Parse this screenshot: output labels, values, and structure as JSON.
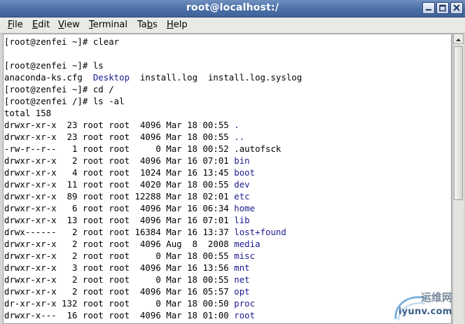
{
  "window": {
    "title": "root@localhost:/"
  },
  "menu": [
    {
      "pre": "",
      "key": "F",
      "post": "ile"
    },
    {
      "pre": "",
      "key": "E",
      "post": "dit"
    },
    {
      "pre": "",
      "key": "V",
      "post": "iew"
    },
    {
      "pre": "",
      "key": "T",
      "post": "erminal"
    },
    {
      "pre": "Ta",
      "key": "b",
      "post": "s"
    },
    {
      "pre": "",
      "key": "H",
      "post": "elp"
    }
  ],
  "terminal": {
    "lines": [
      [
        {
          "t": "[root@zenfei ~]# clear"
        }
      ],
      [
        {
          "t": ""
        }
      ],
      [
        {
          "t": "[root@zenfei ~]# ls"
        }
      ],
      [
        {
          "t": "anaconda-ks.cfg  "
        },
        {
          "t": "Desktop",
          "c": "dir"
        },
        {
          "t": "  install.log  install.log.syslog"
        }
      ],
      [
        {
          "t": "[root@zenfei ~]# cd /"
        }
      ],
      [
        {
          "t": "[root@zenfei /]# ls -al"
        }
      ],
      [
        {
          "t": "total 158"
        }
      ],
      [
        {
          "t": "drwxr-xr-x  23 root root  4096 Mar 18 00:55 "
        },
        {
          "t": ".",
          "c": "dir"
        }
      ],
      [
        {
          "t": "drwxr-xr-x  23 root root  4096 Mar 18 00:55 "
        },
        {
          "t": "..",
          "c": "dir"
        }
      ],
      [
        {
          "t": "-rw-r--r--   1 root root     0 Mar 18 00:52 .autofsck"
        }
      ],
      [
        {
          "t": "drwxr-xr-x   2 root root  4096 Mar 16 07:01 "
        },
        {
          "t": "bin",
          "c": "dir"
        }
      ],
      [
        {
          "t": "drwxr-xr-x   4 root root  1024 Mar 16 13:45 "
        },
        {
          "t": "boot",
          "c": "dir"
        }
      ],
      [
        {
          "t": "drwxr-xr-x  11 root root  4020 Mar 18 00:55 "
        },
        {
          "t": "dev",
          "c": "dir"
        }
      ],
      [
        {
          "t": "drwxr-xr-x  89 root root 12288 Mar 18 02:01 "
        },
        {
          "t": "etc",
          "c": "dir"
        }
      ],
      [
        {
          "t": "drwxr-xr-x   6 root root  4096 Mar 16 06:34 "
        },
        {
          "t": "home",
          "c": "dir"
        }
      ],
      [
        {
          "t": "drwxr-xr-x  13 root root  4096 Mar 16 07:01 "
        },
        {
          "t": "lib",
          "c": "dir"
        }
      ],
      [
        {
          "t": "drwx------   2 root root 16384 Mar 16 13:37 "
        },
        {
          "t": "lost+found",
          "c": "dir"
        }
      ],
      [
        {
          "t": "drwxr-xr-x   2 root root  4096 Aug  8  2008 "
        },
        {
          "t": "media",
          "c": "dir"
        }
      ],
      [
        {
          "t": "drwxr-xr-x   2 root root     0 Mar 18 00:55 "
        },
        {
          "t": "misc",
          "c": "dir"
        }
      ],
      [
        {
          "t": "drwxr-xr-x   3 root root  4096 Mar 16 13:56 "
        },
        {
          "t": "mnt",
          "c": "dir"
        }
      ],
      [
        {
          "t": "drwxr-xr-x   2 root root     0 Mar 18 00:55 "
        },
        {
          "t": "net",
          "c": "dir"
        }
      ],
      [
        {
          "t": "drwxr-xr-x   2 root root  4096 Mar 16 05:57 "
        },
        {
          "t": "opt",
          "c": "dir"
        }
      ],
      [
        {
          "t": "dr-xr-xr-x 132 root root     0 Mar 18 00:50 "
        },
        {
          "t": "proc",
          "c": "dir"
        }
      ],
      [
        {
          "t": "drwxr-x---  16 root root  4096 Mar 18 01:00 "
        },
        {
          "t": "root",
          "c": "dir"
        }
      ]
    ]
  },
  "watermark": {
    "cn": "运维网",
    "en": "iyunv.com"
  },
  "colors": {
    "titlebar": "#4a6ea6",
    "directory": "#1a1a8f",
    "terminal_bg": "#ffffff"
  }
}
